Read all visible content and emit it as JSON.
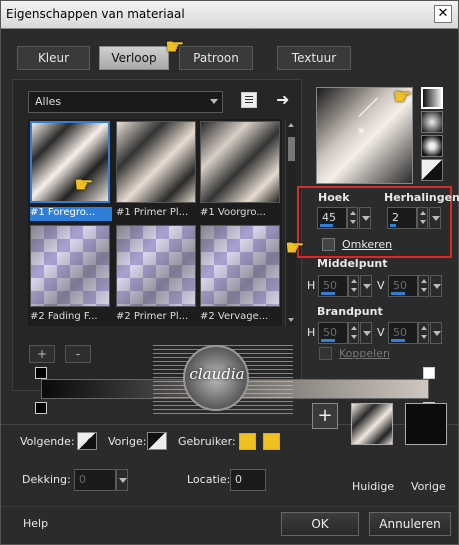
{
  "window": {
    "title": "Eigenschappen van materiaal",
    "close_glyph": "✕"
  },
  "tabs": [
    {
      "label": "Kleur",
      "active": false
    },
    {
      "label": "Verloop",
      "active": true
    },
    {
      "label": "Patroon",
      "active": false
    },
    {
      "label": "Textuur",
      "active": false
    }
  ],
  "category_select": {
    "value": "Alles"
  },
  "gradients": [
    {
      "label": "#1 Foregro...",
      "selected": true
    },
    {
      "label": "#1 Primer Pl...",
      "selected": false
    },
    {
      "label": "#1 Voorgro...",
      "selected": false
    },
    {
      "label": "#2 Fading F...",
      "selected": false
    },
    {
      "label": "#2 Primer Pl...",
      "selected": false
    },
    {
      "label": "#2 Vervage...",
      "selected": false
    }
  ],
  "stop_buttons": {
    "add": "+",
    "remove": "-"
  },
  "angle": {
    "label": "Hoek",
    "value": "45"
  },
  "repeats": {
    "label": "Herhalingen",
    "value": "2"
  },
  "invert": {
    "label": "Omkeren",
    "checked": false
  },
  "center": {
    "label": "Middelpunt",
    "h_label": "H",
    "h_value": "50",
    "v_label": "V",
    "v_value": "50"
  },
  "focal": {
    "label": "Brandpunt",
    "h_label": "H",
    "h_value": "50",
    "v_label": "V",
    "v_value": "50"
  },
  "link": {
    "label": "Koppelen",
    "checked": false
  },
  "bottom": {
    "following_label": "Volgende:",
    "previous_label": "Vorige:",
    "user_label": "Gebruiker:",
    "opacity_label": "Dekking:",
    "opacity_value": "0",
    "location_label": "Locatie:",
    "location_value": "0",
    "user_color": "#f0c020"
  },
  "swatches": {
    "add": "+",
    "current_label": "Huidige",
    "previous_label": "Vorige"
  },
  "footer": {
    "help": "Help",
    "ok": "OK",
    "cancel": "Annuleren"
  },
  "watermark": {
    "text": "claudia"
  },
  "colors": {
    "accent": "#2f7fd8",
    "highlight": "#d42a2a"
  }
}
